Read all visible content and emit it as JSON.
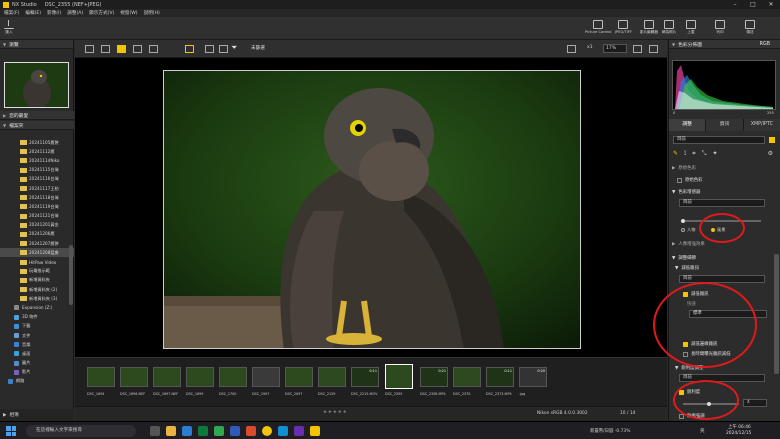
{
  "window": {
    "title": "NX Studio",
    "file": "DSC_2355 (NEF+JPEG)"
  },
  "menu": [
    "檔案(F)",
    "編輯(E)",
    "影像(I)",
    "調整(A)",
    "顯示方式(V)",
    "視窗(W)",
    "說明(H)"
  ],
  "toolbar": {
    "import_label": "匯入",
    "right_buttons": [
      "Picture Control",
      "JPEG/TIFF",
      "影片編輯器",
      "轉為照片",
      "上載",
      "列印",
      "傳送"
    ]
  },
  "left_panel": {
    "nav_header": "瀏覽",
    "recent_header": "您的最愛",
    "folders_header": "檔案夾",
    "folders": [
      "20241105鷹鷲",
      "20241112鷹",
      "20241114Niko",
      "20241115台灣",
      "20241116台灣",
      "20241117王柏",
      "20241118台灣",
      "20241119台灣",
      "20241121台灣",
      "20241201黃金",
      "20241206鷹",
      "20241207鷹鷲",
      "20241208猛禽",
      "HitPaw Video",
      "玩電推示範",
      "新增資料夾",
      "新增資料夾 (2)",
      "新增資料夾 (3)"
    ],
    "selected_folder_index": 12,
    "system": [
      "Expansion (Z:)",
      "3D 物件",
      "下載",
      "文件",
      "音樂",
      "桌面",
      "圖片",
      "影片",
      "網路"
    ],
    "status": "相簿"
  },
  "center_bar": {
    "filter_label": "未篩選",
    "zoom": "17%",
    "zoom_prefix": "x1"
  },
  "filmstrip": {
    "thumbs": [
      "DSC_1694",
      "DSC_1696.NEF",
      "DSC_1697.NEF",
      "DSC_1699",
      "DSC_1700",
      "DSC_1907",
      "DSC_2097",
      "DSC_2129",
      "DSC_2215.MOV",
      "DSC_2355",
      "DSC_2358.MP4",
      "DSC_2370",
      "DSC_2373.MP4",
      ".jpg"
    ],
    "selected_index": 9,
    "durations": [
      "0:11",
      "0:21",
      "0:11",
      "0:20"
    ],
    "profile": "Nikon sRGB 4.0.0.3002",
    "position": "10 / 14"
  },
  "right_panel": {
    "histogram_title": "色彩分佈圖",
    "histogram_mode": "RGB",
    "hist_min": "0",
    "hist_max": "255",
    "tabs": [
      "調整",
      "資訊",
      "XMP/IPTC"
    ],
    "preset": "目前",
    "sections": {
      "base_color": "原始色彩",
      "mode_label": "色彩增感器",
      "mode_value": "目前",
      "radio_a": "人物",
      "radio_b": "風景",
      "smart": "人像增強效果",
      "adjust": "調整細節",
      "noise": "減低雜訊",
      "noise_value": "目前",
      "noise_chk": "減低雜訊",
      "noise_opt": "快速",
      "noise_mode": "標準",
      "edge": "減低邊緣雜訊",
      "sharp": "長時間曝光雜訊減低",
      "clarity": "銳利度調整",
      "clarity_value": "目前",
      "sharpen_chk": "銳利度",
      "sharpen_val": "4",
      "rp": "輪廓強調"
    },
    "accent": "#f5c400",
    "annotation_color": "#e01a1a"
  },
  "taskbar": {
    "search_placeholder": "在這裡輸入文字來搜尋",
    "weather": "新臺幣/日圓 -0.73%",
    "ime": "英",
    "time": "上午 06:46",
    "date": "2024/12/15"
  }
}
